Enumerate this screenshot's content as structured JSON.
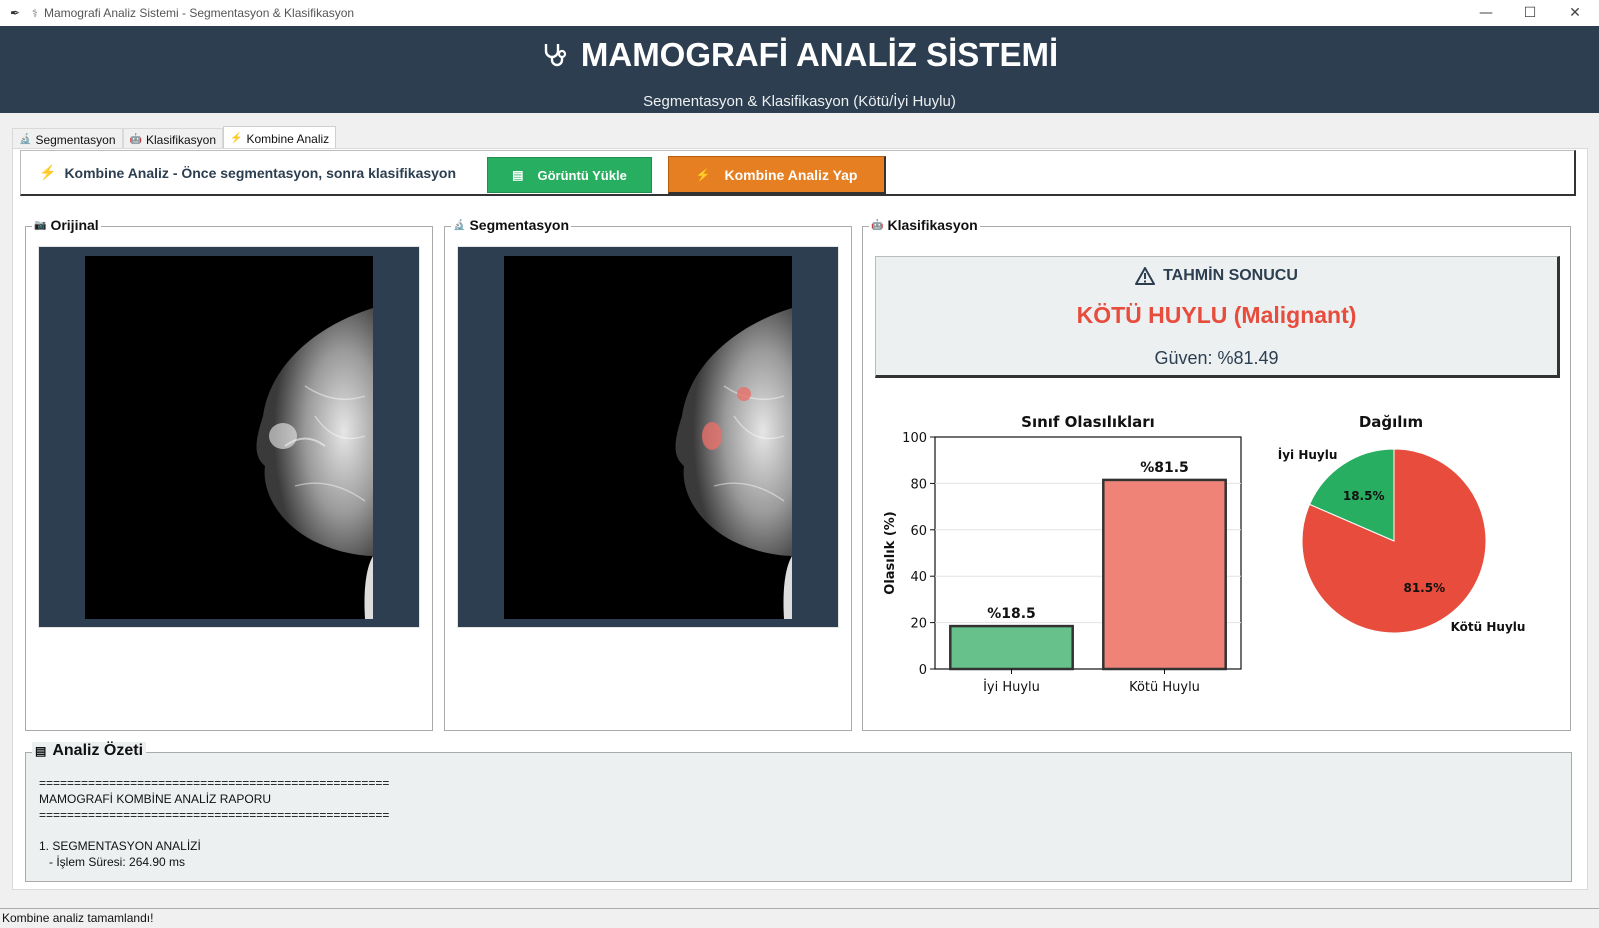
{
  "window": {
    "title": "Mamografi Analiz Sistemi - Segmentasyon & Klasifikasyon",
    "controls": {
      "minimize": "—",
      "maximize": "☐",
      "close": "✕"
    }
  },
  "header": {
    "title": "MAMOGRAFİ ANALİZ SİSTEMİ",
    "subtitle": "Segmentasyon & Klasifikasyon (Kötü/İyi Huylu)",
    "icon": "stethoscope-icon"
  },
  "tabs": [
    {
      "label": "Segmentasyon",
      "icon": "microscope-icon",
      "active": false
    },
    {
      "label": "Klasifikasyon",
      "icon": "robot-icon",
      "active": false
    },
    {
      "label": "Kombine Analiz",
      "icon": "lightning-icon",
      "active": true
    }
  ],
  "toolbar": {
    "label": "Kombine Analiz - Önce segmentasyon, sonra klasifikasyon",
    "load_button": "Görüntü Yükle",
    "analyze_button": "Kombine Analiz Yap"
  },
  "frames": {
    "original": "Orijinal",
    "segmentation": "Segmentasyon",
    "classification": "Klasifikasyon"
  },
  "prediction": {
    "title": "TAHMİN SONUCU",
    "value": "KÖTÜ HUYLU (Malignant)",
    "confidence": "Güven: %81.49"
  },
  "chart_data": [
    {
      "type": "bar",
      "title": "Sınıf Olasılıkları",
      "ylabel": "Olasılık (%)",
      "xlabel": "",
      "categories": [
        "İyi Huylu",
        "Kötü Huylu"
      ],
      "values": [
        18.5,
        81.5
      ],
      "data_labels": [
        "%18.5",
        "%81.5"
      ],
      "ylim": [
        0,
        100
      ],
      "yticks": [
        0,
        20,
        40,
        60,
        80,
        100
      ],
      "colors": [
        "#66c28a",
        "#ef8378"
      ],
      "grid": true
    },
    {
      "type": "pie",
      "title": "Dağılım",
      "labels": [
        "İyi Huylu",
        "Kötü Huylu"
      ],
      "values": [
        18.5,
        81.5
      ],
      "pct_labels": [
        "18.5%",
        "81.5%"
      ],
      "colors": [
        "#27ae60",
        "#e74c3c"
      ]
    }
  ],
  "summary": {
    "title": "Analiz Özeti",
    "lines": [
      "==================================================",
      "MAMOGRAFİ KOMBİNE ANALİZ RAPORU",
      "==================================================",
      "",
      "1. SEGMENTASYON ANALİZİ",
      "   - İşlem Süresi: 264.90 ms"
    ]
  },
  "status": "Kombine analiz tamamlandı!",
  "colors": {
    "header_bg": "#2c3e50",
    "green": "#27ae60",
    "orange": "#e67e22",
    "red": "#e74c3c"
  }
}
